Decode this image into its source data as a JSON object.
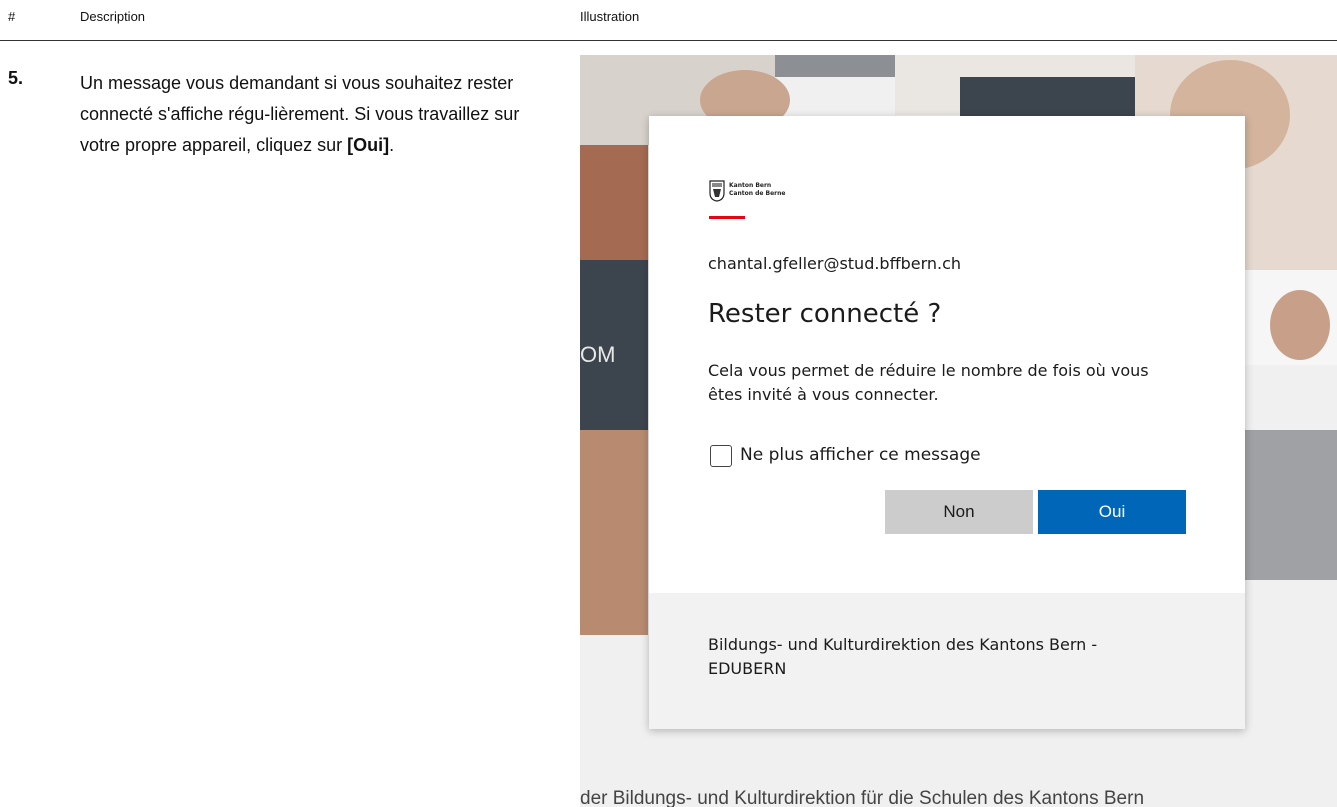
{
  "table_header": {
    "col_num": "#",
    "col_desc": "Description",
    "col_illus": "Illustration"
  },
  "step": {
    "number": "5.",
    "text_before": "Un message vous demandant si vous souhaitez rester connecté s'affiche régu-lièrement. Si vous travaillez sur votre propre appareil, cliquez sur ",
    "text_bold": "[Oui]",
    "text_after": "."
  },
  "background": {
    "partial_text": "OM",
    "footer_text": "der Bildungs- und Kulturdirektion für die Schulen des Kantons Bern"
  },
  "dialog": {
    "logo_line1": "Kanton Bern",
    "logo_line2": "Canton de Berne",
    "logo_icon": "bern-coat-of-arms-icon",
    "email": "chantal.gfeller@stud.bffbern.ch",
    "title": "Rester connecté ?",
    "description": "Cela vous permet de réduire le nombre de fois où vous êtes invité à vous connecter.",
    "checkbox_label": "Ne plus afficher ce message",
    "button_no": "Non",
    "button_yes": "Oui",
    "footer": "Bildungs- und Kulturdirektion des Kantons Bern - EDUBERN"
  },
  "colors": {
    "primary": "#0067b8",
    "secondary_button": "#cccccc",
    "accent_red": "#e30613"
  }
}
